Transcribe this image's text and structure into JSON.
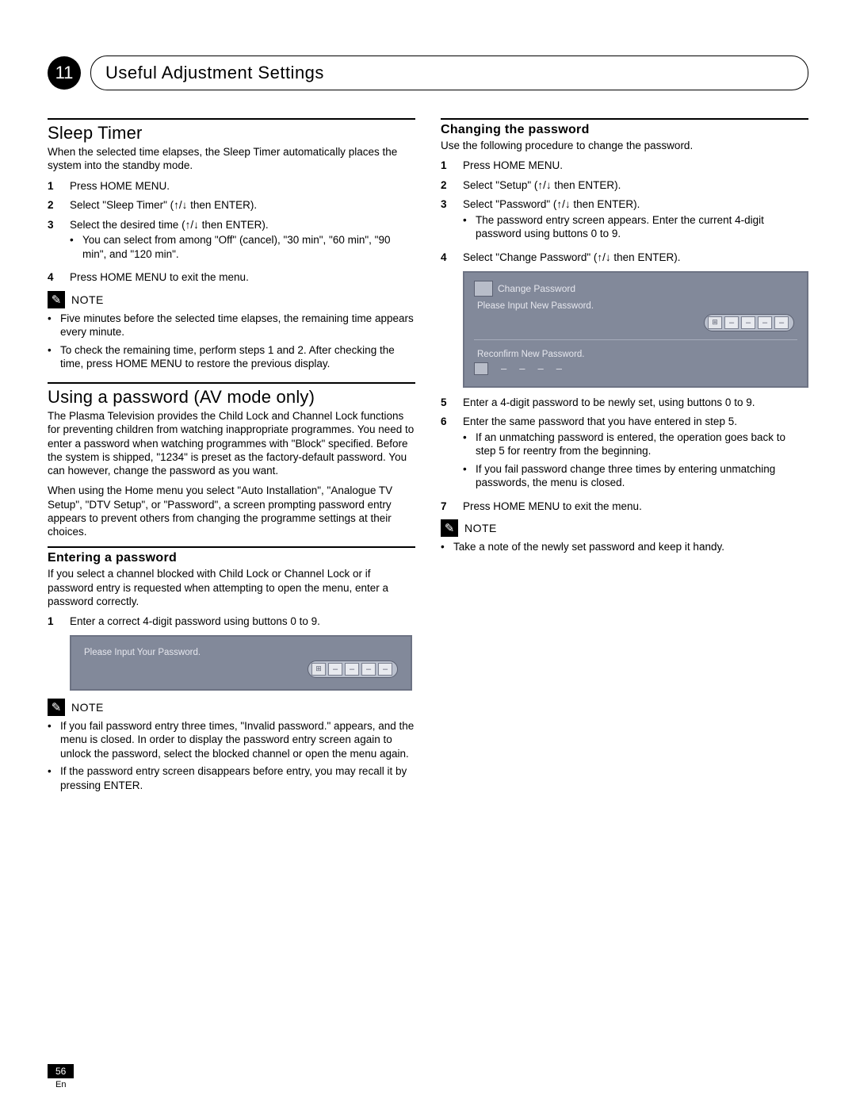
{
  "chapter": {
    "number": "11",
    "title": "Useful Adjustment Settings"
  },
  "sleep": {
    "heading": "Sleep Timer",
    "intro": "When the selected time elapses, the Sleep Timer automatically places the system into the standby mode.",
    "steps": [
      "Press HOME MENU.",
      "Select \"Sleep Timer\" (↑/↓ then ENTER).",
      "Select the desired time (↑/↓ then ENTER).",
      "Press HOME MENU to exit the menu."
    ],
    "step3_sub": "You can select from among \"Off\" (cancel), \"30 min\", \"60 min\", \"90 min\", and \"120 min\".",
    "note_label": "NOTE",
    "notes": [
      "Five minutes before the selected time elapses, the remaining time appears every minute.",
      "To check the remaining time, perform steps 1 and 2. After checking the time, press HOME MENU to restore the previous display."
    ]
  },
  "password": {
    "heading": "Using a password (AV mode only)",
    "intro1": "The Plasma Television provides the Child Lock and Channel Lock functions for preventing children from watching inappropriate programmes. You need to enter a password when watching programmes with \"Block\" specified. Before the system is shipped, \"1234\" is preset as the factory-default password. You can however, change the password as you want.",
    "intro2": "When using the Home menu you select \"Auto Installation\", \"Analogue TV Setup\", \"DTV Setup\", or \"Password\", a screen prompting password entry appears to prevent others from changing the programme settings at their choices."
  },
  "enter": {
    "heading": "Entering a password",
    "intro": "If you select a channel blocked with Child Lock or Channel Lock or if password entry is requested when attempting to open the menu, enter a password correctly.",
    "step1": "Enter a correct 4-digit password using buttons 0 to 9.",
    "osd_prompt": "Please Input Your Password.",
    "note_label": "NOTE",
    "notes": [
      "If you fail password entry three times, \"Invalid password.\" appears, and the menu is closed. In order to display the password entry screen again to unlock the password, select the blocked channel or open the menu again.",
      "If the password entry screen disappears before entry, you may recall it by pressing ENTER."
    ]
  },
  "change": {
    "heading": "Changing the password",
    "intro": "Use the following procedure to change the password.",
    "steps": [
      "Press HOME MENU.",
      "Select \"Setup\" (↑/↓ then ENTER).",
      "Select \"Password\" (↑/↓ then ENTER).",
      "Select \"Change Password\" (↑/↓ then ENTER)."
    ],
    "step3_sub": "The password entry screen appears. Enter the current 4-digit password using buttons 0 to 9.",
    "osd_title": "Change Password",
    "osd_prompt1": "Please Input New Password.",
    "osd_prompt2": "Reconfirm New Password.",
    "step5": "Enter a 4-digit password to be newly set, using buttons 0 to 9.",
    "step6": "Enter the same password that you have entered in step 5.",
    "step6_subs": [
      "If an unmatching password is entered, the operation goes back to step 5 for reentry from the beginning.",
      "If you fail password change three times by entering unmatching passwords, the menu is closed."
    ],
    "step7": "Press HOME MENU to exit the menu.",
    "note_label": "NOTE",
    "note1": "Take a note of the newly set password and keep it handy."
  },
  "footer": {
    "page": "56",
    "lang": "En"
  }
}
